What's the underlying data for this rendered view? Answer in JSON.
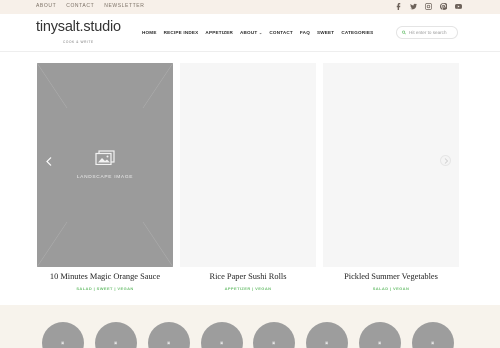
{
  "topbar": {
    "links": [
      "ABOUT",
      "CONTACT",
      "NEWSLETTER"
    ],
    "social_icons": [
      "facebook-icon",
      "twitter-icon",
      "instagram-icon",
      "pinterest-icon",
      "youtube-icon"
    ]
  },
  "header": {
    "logo_name": "tinysalt.studio",
    "logo_tag": "COOK & WRITE",
    "nav": [
      "HOME",
      "RECIPE INDEX",
      "APPETIZER",
      "ABOUT",
      "CONTACT",
      "FAQ",
      "SWEET",
      "CATEGORIES"
    ],
    "search_placeholder": "Hit enter to search"
  },
  "slider": {
    "placeholder_label": "LANDSCAPE IMAGE",
    "cards": [
      {
        "title": "10 Minutes Magic Orange Sauce",
        "categories": "SALAD | SWEET | VEGAN"
      },
      {
        "title": "Rice Paper Sushi Rolls",
        "categories": "APPETIZER | VEGAN"
      },
      {
        "title": "Pickled Summer Vegetables",
        "categories": "SALAD | VEGAN"
      }
    ]
  },
  "colors": {
    "topbar_bg": "#f7f0e9",
    "category_green": "#6cbf6f",
    "placeholder_grey": "#9b9b9b",
    "bottom_bg": "#f7f3ec"
  }
}
